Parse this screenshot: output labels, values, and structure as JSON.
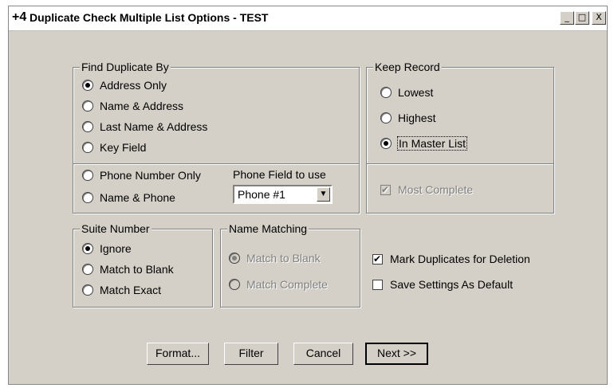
{
  "window": {
    "title": "Duplicate Check Multiple List Options - TEST",
    "icon_text": "+4",
    "controls": [
      "_",
      "□",
      "X"
    ]
  },
  "find_duplicate_by": {
    "legend": "Find Duplicate By",
    "options": [
      {
        "label": "Address Only",
        "selected": true
      },
      {
        "label": "Name & Address",
        "selected": false
      },
      {
        "label": "Last Name & Address",
        "selected": false
      },
      {
        "label": "Key Field",
        "selected": false
      },
      {
        "label": "Phone Number Only",
        "selected": false
      },
      {
        "label": "Name & Phone",
        "selected": false
      }
    ],
    "phone_field_label": "Phone Field to use",
    "phone_field_value": "Phone #1"
  },
  "keep_record": {
    "legend": "Keep Record",
    "options": [
      {
        "label": "Lowest",
        "selected": false
      },
      {
        "label": "Highest",
        "selected": false
      },
      {
        "label": "In Master List",
        "selected": true
      }
    ],
    "most_complete": {
      "label": "Most Complete",
      "checked": true,
      "disabled": true
    }
  },
  "suite_number": {
    "legend": "Suite Number",
    "options": [
      {
        "label": "Ignore",
        "selected": true
      },
      {
        "label": "Match to Blank",
        "selected": false
      },
      {
        "label": "Match Exact",
        "selected": false
      }
    ]
  },
  "name_matching": {
    "legend": "Name Matching",
    "options": [
      {
        "label": "Match to Blank",
        "selected": true,
        "disabled": true
      },
      {
        "label": "Match Complete",
        "selected": false,
        "disabled": true
      }
    ]
  },
  "checkboxes": {
    "mark_duplicates": {
      "label": "Mark Duplicates for Deletion",
      "checked": true
    },
    "save_settings": {
      "label": "Save Settings As Default",
      "checked": false
    }
  },
  "buttons": {
    "format": "Format...",
    "filter": "Filter",
    "cancel": "Cancel",
    "next": "Next >>"
  }
}
